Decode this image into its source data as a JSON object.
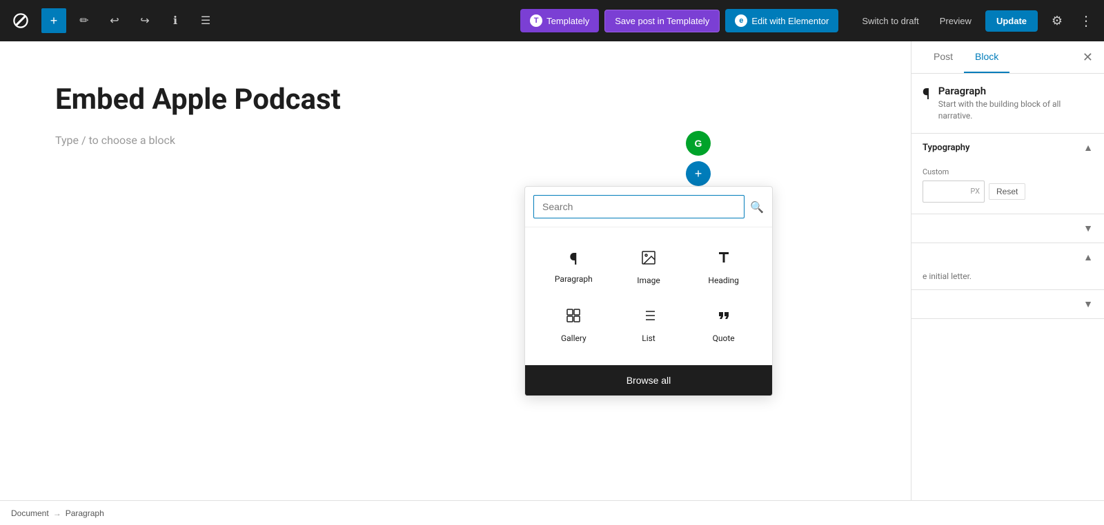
{
  "toolbar": {
    "add_label": "+",
    "pen_icon": "✏",
    "undo_icon": "↩",
    "redo_icon": "↪",
    "info_icon": "ℹ",
    "list_icon": "☰",
    "templately_label": "Templately",
    "save_templately_label": "Save post in Templately",
    "elementor_label": "Edit with Elementor",
    "switch_draft_label": "Switch to draft",
    "preview_label": "Preview",
    "update_label": "Update",
    "settings_icon": "⚙",
    "more_icon": "⋮"
  },
  "editor": {
    "post_title": "Embed Apple Podcast",
    "block_placeholder": "Type / to choose a block"
  },
  "sidebar": {
    "tab_post_label": "Post",
    "tab_block_label": "Block",
    "close_icon": "✕",
    "block_name": "Paragraph",
    "block_description": "Start with the building block of all narrative.",
    "typography_label": "Typography",
    "typography_chevron_up": "▲",
    "custom_label": "Custom",
    "custom_unit": "PX",
    "reset_label": "Reset",
    "collapsed_section_1_chevron": "▼",
    "collapsed_section_2_chevron": "▲",
    "partial_text": "e initial letter.",
    "collapsed_section_3_chevron": "▼"
  },
  "inserter": {
    "search_placeholder": "Search",
    "search_icon": "🔍",
    "items": [
      {
        "label": "Paragraph",
        "icon": "¶"
      },
      {
        "label": "Image",
        "icon": "🖼"
      },
      {
        "label": "Heading",
        "icon": "🔖"
      },
      {
        "label": "Gallery",
        "icon": "▦"
      },
      {
        "label": "List",
        "icon": "≡"
      },
      {
        "label": "Quote",
        "icon": "❝"
      }
    ],
    "browse_all_label": "Browse all"
  },
  "breadcrumb": {
    "document_label": "Document",
    "arrow": "→",
    "paragraph_label": "Paragraph"
  },
  "float_controls": {
    "green_icon": "G",
    "blue_icon": "+"
  }
}
